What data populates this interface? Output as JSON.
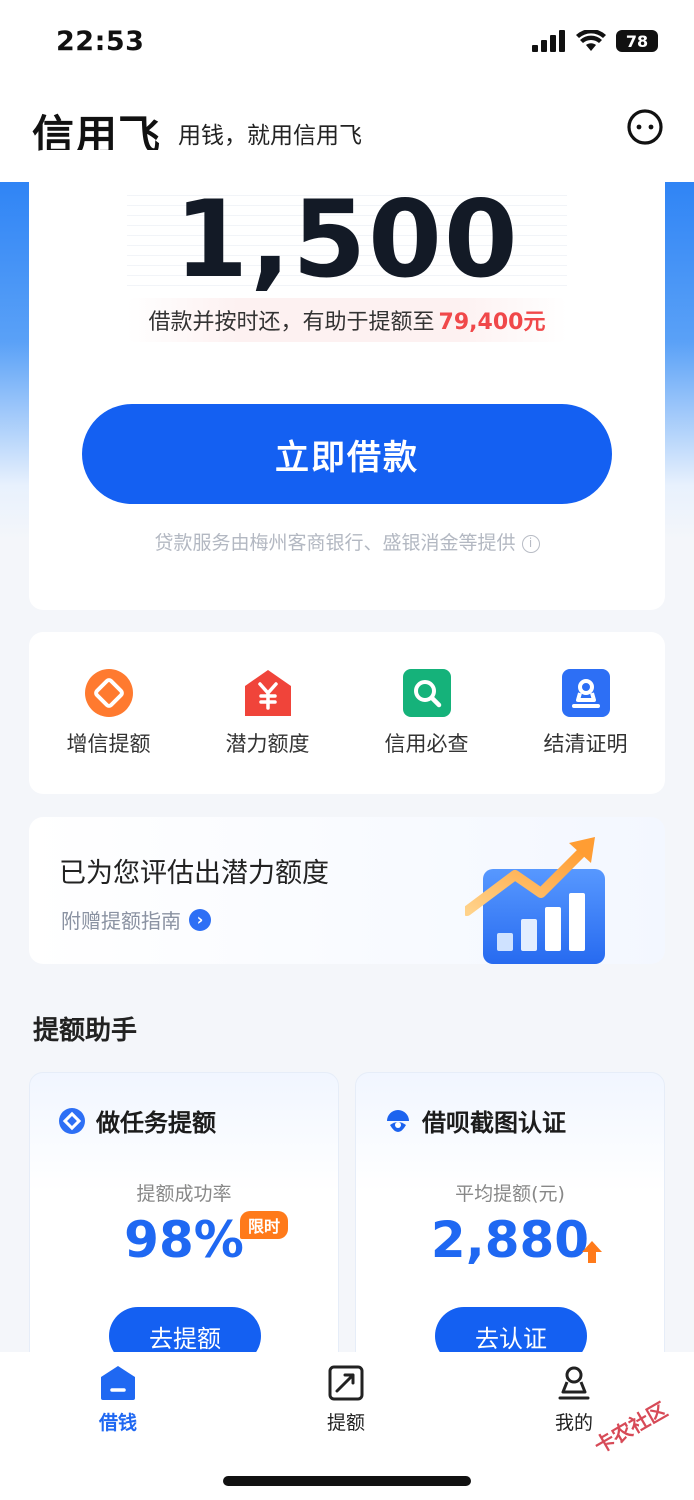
{
  "status_bar": {
    "time": "22:53",
    "battery": "78"
  },
  "header": {
    "brand": "信用飞",
    "slogan": "用钱，就用信用飞"
  },
  "loan_card": {
    "amount": "1,500",
    "hint_text": "借款并按时还，有助于提额至",
    "hint_amount": "79,400元",
    "button_label": "立即借款",
    "provider_note": "贷款服务由梅州客商银行、盛银消金等提供",
    "info_symbol": "i"
  },
  "quick_menu": [
    {
      "label": "增信提额",
      "icon": "diamond-badge-icon",
      "color": "#ff7a2f"
    },
    {
      "label": "潜力额度",
      "icon": "yuan-house-icon",
      "color": "#f0443a"
    },
    {
      "label": "信用必查",
      "icon": "magnifier-icon",
      "color": "#15b27a"
    },
    {
      "label": "结清证明",
      "icon": "stamp-icon",
      "color": "#2d6ff5"
    }
  ],
  "promo": {
    "title": "已为您评估出潜力额度",
    "subtitle": "附赠提额指南",
    "arrow": "›"
  },
  "section": {
    "title": "提额助手"
  },
  "tasks": [
    {
      "title": "做任务提额",
      "metric_label": "提额成功率",
      "metric_value": "98%",
      "badge": "限时",
      "button": "去提额"
    },
    {
      "title": "借呗截图认证",
      "metric_label": "平均提额(元)",
      "metric_value": "2,880",
      "button": "去认证"
    }
  ],
  "tab_bar": [
    {
      "label": "借钱",
      "icon": "home-wallet-icon",
      "active": true
    },
    {
      "label": "提额",
      "icon": "trend-card-icon",
      "active": false
    },
    {
      "label": "我的",
      "icon": "user-icon",
      "active": false
    }
  ],
  "watermark": "卡农社区",
  "colors": {
    "primary": "#1460f2",
    "highlight": "#f0484a",
    "badge": "#ff7a1a"
  }
}
